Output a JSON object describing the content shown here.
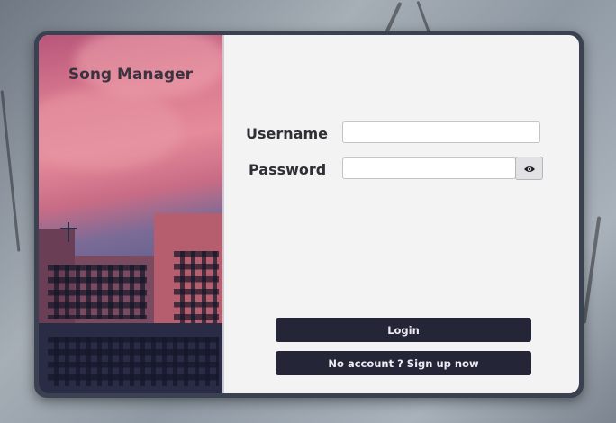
{
  "app": {
    "title": "Song Manager"
  },
  "form": {
    "username_label": "Username",
    "username_value": "",
    "password_label": "Password",
    "password_value": ""
  },
  "buttons": {
    "login_label": "Login",
    "signup_label": "No account ? Sign up now"
  },
  "icons": {
    "password_toggle": "eye-icon"
  },
  "colors": {
    "button_bg": "#252538",
    "button_text": "#ececf2",
    "card_bg": "#f3f3f3",
    "window_border": "#3a4150"
  }
}
